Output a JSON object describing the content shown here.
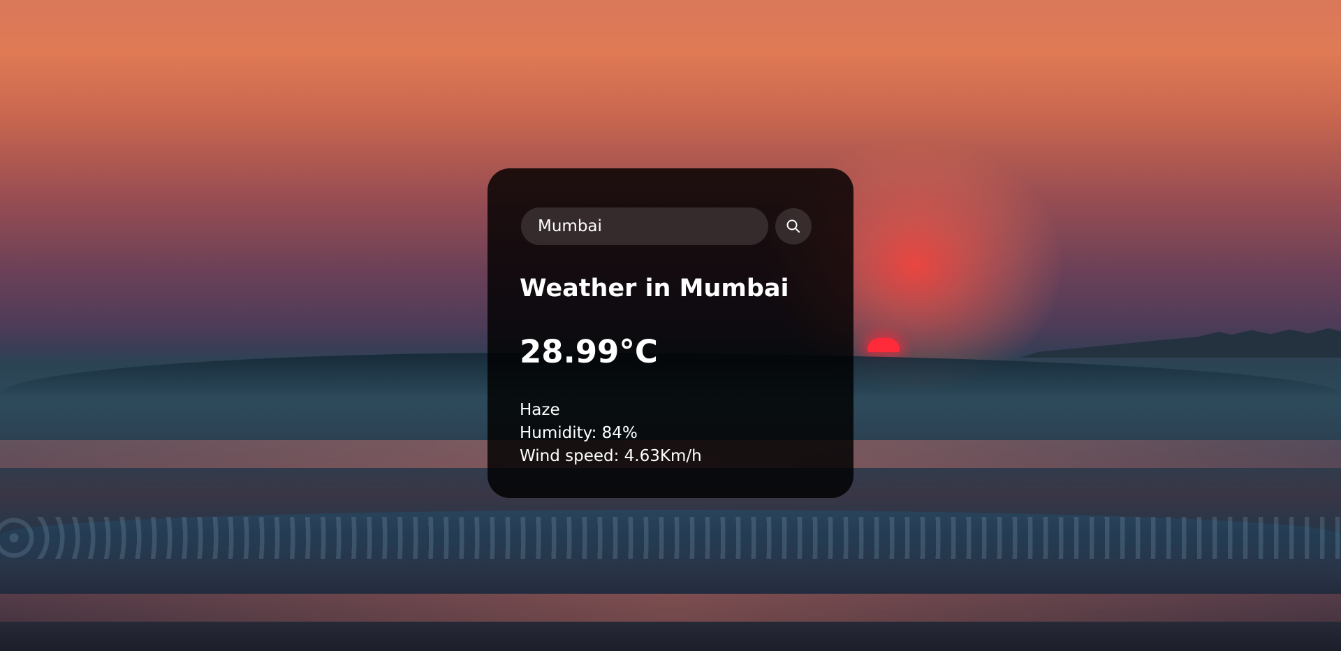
{
  "search": {
    "value": "Mumbai"
  },
  "weather": {
    "title": "Weather in Mumbai",
    "temperature": "28.99°C",
    "description": "Haze",
    "humidity": "Humidity: 84%",
    "wind": "Wind speed: 4.63Km/h"
  },
  "icons": {
    "search": "search-icon"
  }
}
